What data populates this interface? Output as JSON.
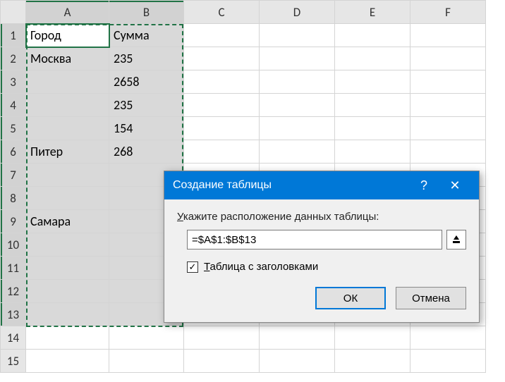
{
  "columns": [
    "A",
    "B",
    "C",
    "D",
    "E",
    "F"
  ],
  "rowCount": 15,
  "cells": {
    "A1": "Город",
    "B1": "Сумма",
    "A2": "Москва",
    "B2": "235",
    "B3": "2658",
    "B4": "235",
    "B5": "154",
    "A6": "Питер",
    "B6": "268",
    "A9": "Самара"
  },
  "selection": {
    "startCol": "A",
    "endCol": "B",
    "startRow": 1,
    "endRow": 13,
    "activeCell": "A1"
  },
  "dialog": {
    "title": "Создание таблицы",
    "label": "Укажите расположение данных таблицы:",
    "rangeValue": "=$A$1:$B$13",
    "checkboxLabel": "Таблица с заголовками",
    "checkboxChecked": true,
    "ok": "ОК",
    "cancel": "Отмена"
  }
}
